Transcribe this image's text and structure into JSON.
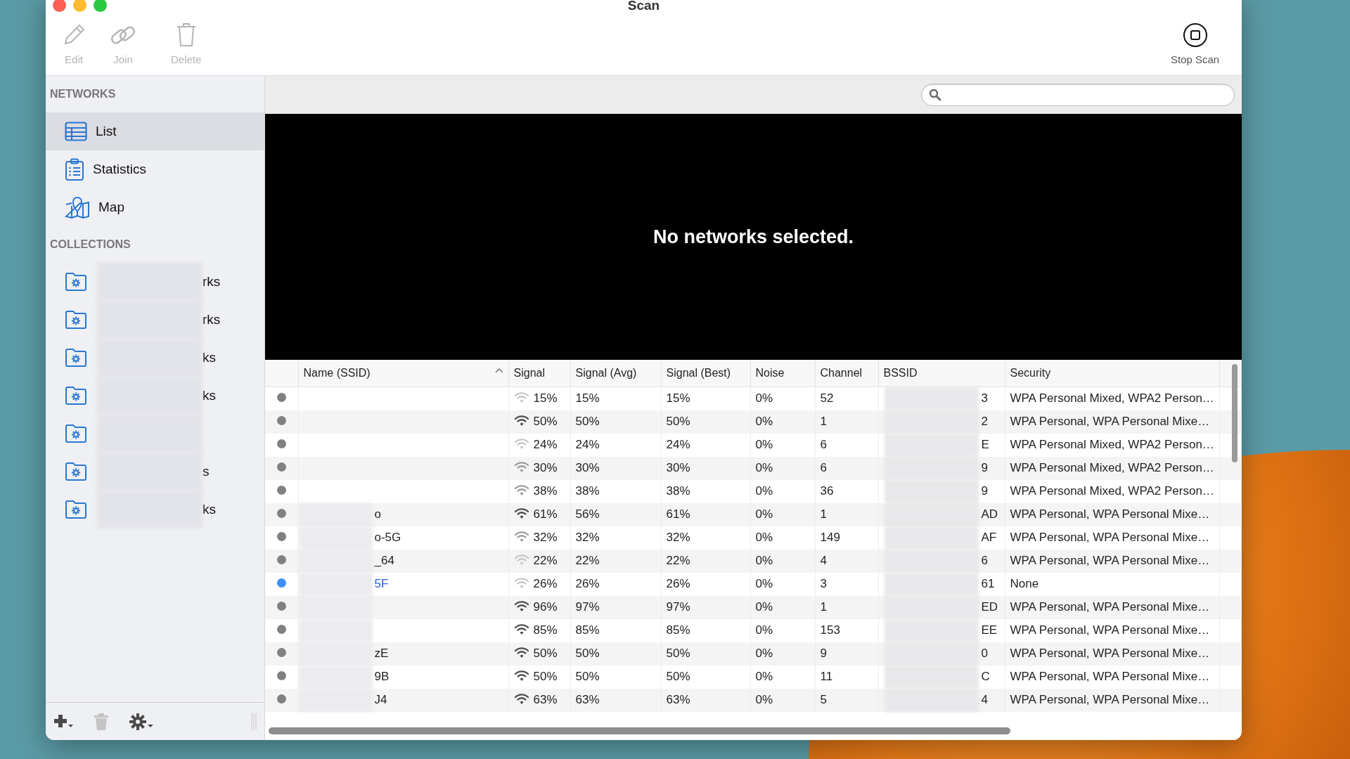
{
  "window": {
    "title": "Scan"
  },
  "toolbar": [
    {
      "label": "Edit",
      "kind": "edit",
      "disabled": true
    },
    {
      "label": "Join",
      "kind": "join",
      "disabled": true
    },
    {
      "label": "Delete",
      "kind": "delete",
      "disabled": true
    },
    {
      "label": "Stop Scan",
      "kind": "stop",
      "disabled": false
    }
  ],
  "sidebar": {
    "sections": [
      {
        "heading": "NETWORKS",
        "items": [
          {
            "label": "List",
            "kind": "table",
            "selected": true
          },
          {
            "label": "Statistics",
            "kind": "clipboard",
            "selected": false
          },
          {
            "label": "Map",
            "kind": "map",
            "selected": false
          }
        ]
      },
      {
        "heading": "COLLECTIONS",
        "items": [
          {
            "label": "rks",
            "kind": "folder",
            "selected": false,
            "blurred": true
          },
          {
            "label": "rks",
            "kind": "folder",
            "selected": false,
            "blurred": true
          },
          {
            "label": "ks",
            "kind": "folder",
            "selected": false,
            "blurred": true
          },
          {
            "label": "ks",
            "kind": "folder",
            "selected": false,
            "blurred": true
          },
          {
            "kind": "folder",
            "selected": false,
            "blurred": true
          },
          {
            "label": "s",
            "kind": "folder",
            "selected": false,
            "blurred": true
          },
          {
            "label": "ks",
            "kind": "folder",
            "selected": false,
            "blurred": true
          }
        ]
      }
    ],
    "footer": [
      {
        "kind": "add",
        "disabled": false
      },
      {
        "kind": "delete",
        "disabled": true
      },
      {
        "kind": "settings",
        "disabled": false
      }
    ]
  },
  "detail": {
    "message": "No networks selected."
  },
  "table": {
    "columns": [
      {
        "label": "Name (SSID)",
        "sorted": true
      },
      {
        "label": "Signal",
        "sorted": false
      },
      {
        "label": "Signal (Avg)",
        "sorted": false
      },
      {
        "label": "Signal (Best)",
        "sorted": false
      },
      {
        "label": "Noise",
        "sorted": false
      },
      {
        "label": "Channel",
        "sorted": false
      },
      {
        "label": "BSSID",
        "sorted": false
      },
      {
        "label": "Security",
        "sorted": false
      }
    ],
    "rows": [
      {
        "color": "#808080",
        "name_blurred": false,
        "kind": "weak",
        "signal": "15%",
        "avg": "15%",
        "best": "15%",
        "noise": "0%",
        "channel": "52",
        "bssid": "3",
        "security": "WPA Personal Mixed, WPA2 Person…"
      },
      {
        "color": "#808080",
        "name_blurred": false,
        "kind": "strong",
        "signal": "50%",
        "avg": "50%",
        "best": "50%",
        "noise": "0%",
        "channel": "1",
        "bssid": "2",
        "security": "WPA Personal, WPA Personal Mixe…"
      },
      {
        "color": "#808080",
        "name_blurred": false,
        "kind": "weak",
        "signal": "24%",
        "avg": "24%",
        "best": "24%",
        "noise": "0%",
        "channel": "6",
        "bssid": "E",
        "security": "WPA Personal Mixed, WPA2 Person…"
      },
      {
        "color": "#808080",
        "name_blurred": false,
        "kind": "medium",
        "signal": "30%",
        "avg": "30%",
        "best": "30%",
        "noise": "0%",
        "channel": "6",
        "bssid": "9",
        "security": "WPA Personal Mixed, WPA2 Person…"
      },
      {
        "color": "#808080",
        "name_blurred": false,
        "kind": "medium",
        "signal": "38%",
        "avg": "38%",
        "best": "38%",
        "noise": "0%",
        "channel": "36",
        "bssid": "9",
        "security": "WPA Personal Mixed, WPA2 Person…"
      },
      {
        "color": "#808080",
        "highlighted": false,
        "name_blurred": true,
        "name": "o",
        "kind": "strong",
        "signal": "61%",
        "avg": "56%",
        "best": "61%",
        "noise": "0%",
        "channel": "1",
        "bssid": "AD",
        "security": "WPA Personal, WPA Personal Mixe…"
      },
      {
        "color": "#808080",
        "highlighted": false,
        "name_blurred": true,
        "name": "o-5G",
        "kind": "medium",
        "signal": "32%",
        "avg": "32%",
        "best": "32%",
        "noise": "0%",
        "channel": "149",
        "bssid": "AF",
        "security": "WPA Personal, WPA Personal Mixe…"
      },
      {
        "color": "#808080",
        "highlighted": false,
        "name_blurred": true,
        "name": "_64",
        "kind": "weak",
        "signal": "22%",
        "avg": "22%",
        "best": "22%",
        "noise": "0%",
        "channel": "4",
        "bssid": "6",
        "security": "WPA Personal, WPA Personal Mixe…"
      },
      {
        "color": "#3d8ef5",
        "highlighted": true,
        "name_blurred": true,
        "name": "5F",
        "kind": "weak",
        "signal": "26%",
        "avg": "26%",
        "best": "26%",
        "noise": "0%",
        "channel": "3",
        "bssid": "61",
        "security": "None"
      },
      {
        "color": "#808080",
        "name_blurred": true,
        "kind": "strong",
        "signal": "96%",
        "avg": "97%",
        "best": "97%",
        "noise": "0%",
        "channel": "1",
        "bssid": "ED",
        "security": "WPA Personal, WPA Personal Mixe…"
      },
      {
        "color": "#808080",
        "name_blurred": true,
        "kind": "strong",
        "signal": "85%",
        "avg": "85%",
        "best": "85%",
        "noise": "0%",
        "channel": "153",
        "bssid": "EE",
        "security": "WPA Personal, WPA Personal Mixe…"
      },
      {
        "color": "#808080",
        "highlighted": false,
        "name_blurred": true,
        "name": "zE",
        "kind": "strong",
        "signal": "50%",
        "avg": "50%",
        "best": "50%",
        "noise": "0%",
        "channel": "9",
        "bssid": "0",
        "security": "WPA Personal, WPA Personal Mixe…"
      },
      {
        "color": "#808080",
        "highlighted": false,
        "name_blurred": true,
        "name": "9B",
        "kind": "strong",
        "signal": "50%",
        "avg": "50%",
        "best": "50%",
        "noise": "0%",
        "channel": "11",
        "bssid": "C",
        "security": "WPA Personal, WPA Personal Mixe…"
      },
      {
        "color": "#808080",
        "highlighted": false,
        "name_blurred": true,
        "name": "J4",
        "kind": "strong",
        "signal": "63%",
        "avg": "63%",
        "best": "63%",
        "noise": "0%",
        "channel": "5",
        "bssid": "4",
        "security": "WPA Personal, WPA Personal Mixe…"
      }
    ]
  }
}
